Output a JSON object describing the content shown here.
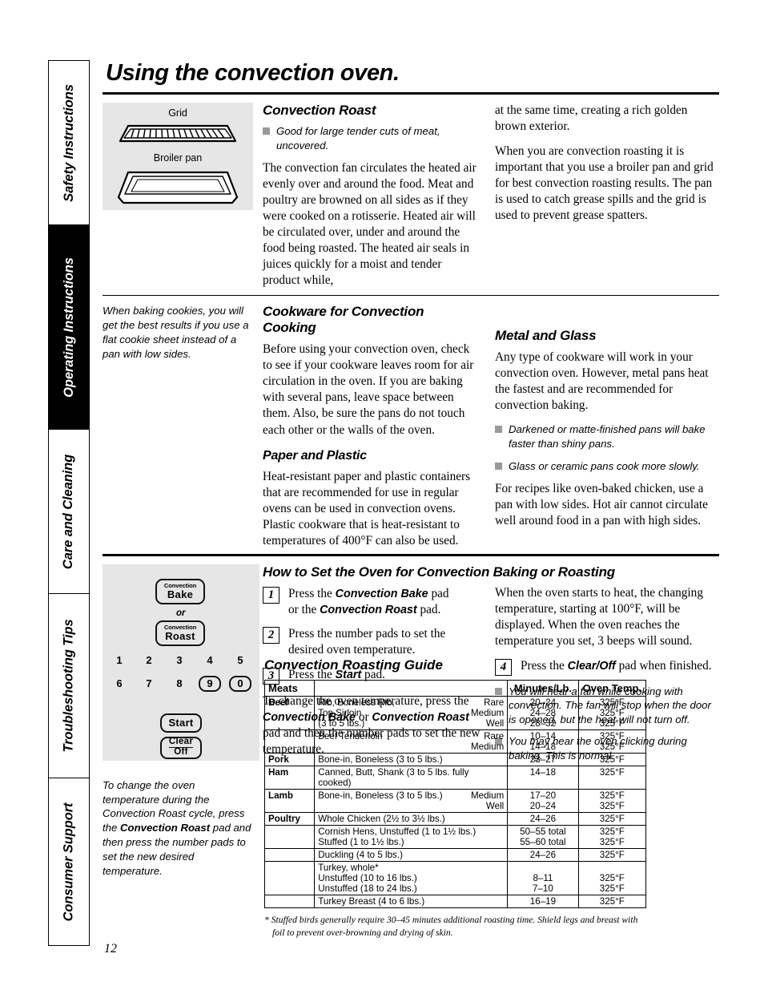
{
  "sidebar": {
    "tabs": [
      {
        "label": "Safety Instructions",
        "active": false
      },
      {
        "label": "Operating Instructions",
        "active": true
      },
      {
        "label": "Care and Cleaning",
        "active": false
      },
      {
        "label": "Troubleshooting Tips",
        "active": false
      },
      {
        "label": "Consumer Support",
        "active": false
      }
    ]
  },
  "page": {
    "title": "Using the convection oven.",
    "number": "12"
  },
  "illustration": {
    "grid_caption": "Grid",
    "pan_caption": "Broiler pan"
  },
  "convection_roast": {
    "heading": "Convection Roast",
    "bullet": "Good for large tender cuts of meat, uncovered.",
    "paragraph_1": "The convection fan circulates the heated air evenly over and around the food. Meat and poultry are browned on all sides as if they were cooked on a rotisserie. Heated air will be circulated over, under and around the food being roasted. The heated air seals in juices quickly for a moist and tender product while, at the same time, creating a rich golden brown exterior.",
    "paragraph_1_cont": "at the same time, creating a rich golden brown exterior.",
    "paragraph_1_part1": "The convection fan circulates the heated air evenly over and around the food. Meat and poultry are browned on all sides as if they were cooked on a rotisserie. Heated air will be circulated over, under and around the food being roasted. The heated air seals in juices quickly for a moist and tender product while,",
    "paragraph_2": "When you are convection roasting it is important that you use a broiler pan and grid for best convection roasting results. The pan is used to catch grease spills and the grid is used to prevent grease spatters."
  },
  "cookware": {
    "sidenote": "When baking cookies, you will get the best results if you use a flat cookie sheet instead of a pan with low sides.",
    "heading": "Cookware for Convection Cooking",
    "paragraph": "Before using your convection oven, check to see if your cookware leaves room for air circulation in the oven. If you are baking with several pans, leave space between them. Also, be sure the pans do not touch each other or the walls of the oven.",
    "paper_plastic_heading": "Paper and Plastic",
    "paper_plastic_paragraph": "Heat-resistant paper and plastic containers that are recommended for use in regular ovens can be used in convection ovens. Plastic cookware that is heat-resistant to temperatures of 400°F can also be used.",
    "metal_glass_heading": "Metal and Glass",
    "metal_glass_paragraph": "Any type of cookware will work in your convection oven. However, metal pans heat the fastest and are recommended for convection baking.",
    "metal_glass_bullets": [
      "Darkened or matte-finished pans will bake faster than shiny pans.",
      "Glass or ceramic pans cook more slowly."
    ],
    "metal_glass_closing": "For recipes like oven-baked chicken, use a pan with low sides. Hot air cannot circulate well around food in a pan with high sides."
  },
  "control_panel": {
    "convection_bake_small": "Convection",
    "convection_bake_big": "Bake",
    "or_label": "or",
    "convection_roast_small": "Convection",
    "convection_roast_big": "Roast",
    "number_row_1": [
      "1",
      "2",
      "3",
      "4",
      "5"
    ],
    "number_row_2": [
      "6",
      "7",
      "8",
      "9",
      "0"
    ],
    "start_label": "Start",
    "clear_label_top": "Clear",
    "clear_label_bottom": "Off"
  },
  "how_to_set": {
    "heading": "How to Set the Oven for Convection Baking or Roasting",
    "steps": [
      {
        "num": "1",
        "html": "Press the <b>Convection Bake</b> pad<br>or the <b>Convection Roast</b> pad."
      },
      {
        "num": "2",
        "html": "Press the number pads to set the desired oven temperature."
      },
      {
        "num": "3",
        "html": "Press the <b>Start</b> pad."
      }
    ],
    "change_temp_html": "To change the oven temperature, press the <b>Convection Bake</b> or <b>Convection Roast</b> pad and then the number pads to set the new temperature.",
    "right_paragraph": "When the oven starts to heat, the changing temperature, starting at 100°F, will be displayed. When the oven reaches the temperature you set, 3 beeps will sound.",
    "step_4": {
      "num": "4",
      "html": "Press the <b>Clear/Off</b> pad when finished."
    },
    "right_bullets": [
      "You will hear a fan while cooking with convection. The fan will stop when the door is opened, but the heat will not turn off.",
      "You may hear the oven clicking during baking. This is normal."
    ],
    "sidenote_html": "To change the oven temperature during the Convection Roast cycle, press the <b>Convection Roast</b> pad and then press the number pads to set the new desired temperature."
  },
  "roasting_guide": {
    "heading": "Convection Roasting Guide",
    "columns": [
      "Meats",
      "",
      "Minutes/Lb.",
      "Oven Temp."
    ],
    "rows": [
      {
        "meat": "Beef",
        "desc_lines": [
          "Rib, Boneless Rib,",
          "Top Sirloin",
          "(3 to 5 lbs.)"
        ],
        "done_lines": [
          "Rare",
          "Medium",
          "Well"
        ],
        "minutes_lines": [
          "20–24",
          "24–28",
          "28–32"
        ],
        "temp_lines": [
          "325°F",
          "325°F",
          "325°F"
        ]
      },
      {
        "meat": "",
        "desc_lines": [
          "Beef Tenderloin",
          ""
        ],
        "done_lines": [
          "Rare",
          "Medium"
        ],
        "minutes_lines": [
          "10–14",
          "14–18"
        ],
        "temp_lines": [
          "325°F",
          "325°F"
        ]
      },
      {
        "meat": "Pork",
        "desc_lines": [
          "Bone-in, Boneless (3 to 5 lbs.)"
        ],
        "done_lines": [
          ""
        ],
        "minutes_lines": [
          "23–27"
        ],
        "temp_lines": [
          "325°F"
        ]
      },
      {
        "meat": "Ham",
        "desc_lines": [
          "Canned, Butt, Shank (3 to 5 lbs. fully cooked)"
        ],
        "done_lines": [
          ""
        ],
        "minutes_lines": [
          "14–18"
        ],
        "temp_lines": [
          "325°F"
        ]
      },
      {
        "meat": "Lamb",
        "desc_lines": [
          "Bone-in, Boneless (3 to 5 lbs.)",
          ""
        ],
        "done_lines": [
          "Medium",
          "Well"
        ],
        "minutes_lines": [
          "17–20",
          "20–24"
        ],
        "temp_lines": [
          "325°F",
          "325°F"
        ]
      },
      {
        "meat": "Poultry",
        "desc_lines": [
          "Whole Chicken (2½ to 3½ lbs.)"
        ],
        "done_lines": [
          ""
        ],
        "minutes_lines": [
          "24–26"
        ],
        "temp_lines": [
          "325°F"
        ]
      },
      {
        "meat": "",
        "desc_lines": [
          "Cornish Hens, Unstuffed (1 to 1½ lbs.)",
          "Stuffed (1 to 1½ lbs.)"
        ],
        "done_lines": [
          "",
          ""
        ],
        "minutes_lines": [
          "50–55 total",
          "55–60 total"
        ],
        "temp_lines": [
          "325°F",
          "325°F"
        ]
      },
      {
        "meat": "",
        "desc_lines": [
          "Duckling (4 to 5 lbs.)"
        ],
        "done_lines": [
          ""
        ],
        "minutes_lines": [
          "24–26"
        ],
        "temp_lines": [
          "325°F"
        ]
      },
      {
        "meat": "",
        "desc_lines": [
          "Turkey, whole*",
          "Unstuffed (10 to 16 lbs.)",
          "Unstuffed (18 to 24 lbs.)"
        ],
        "done_lines": [
          "",
          "",
          ""
        ],
        "minutes_lines": [
          "",
          "8–11",
          "7–10"
        ],
        "temp_lines": [
          "",
          "325°F",
          "325°F"
        ]
      },
      {
        "meat": "",
        "desc_lines": [
          "Turkey Breast (4 to 6 lbs.)"
        ],
        "done_lines": [
          ""
        ],
        "minutes_lines": [
          "16–19"
        ],
        "temp_lines": [
          "325°F"
        ]
      }
    ],
    "footnote": "* Stuffed birds generally require 30–45 minutes additional roasting time. Shield legs and breast with foil to prevent over-browning and drying of skin."
  }
}
